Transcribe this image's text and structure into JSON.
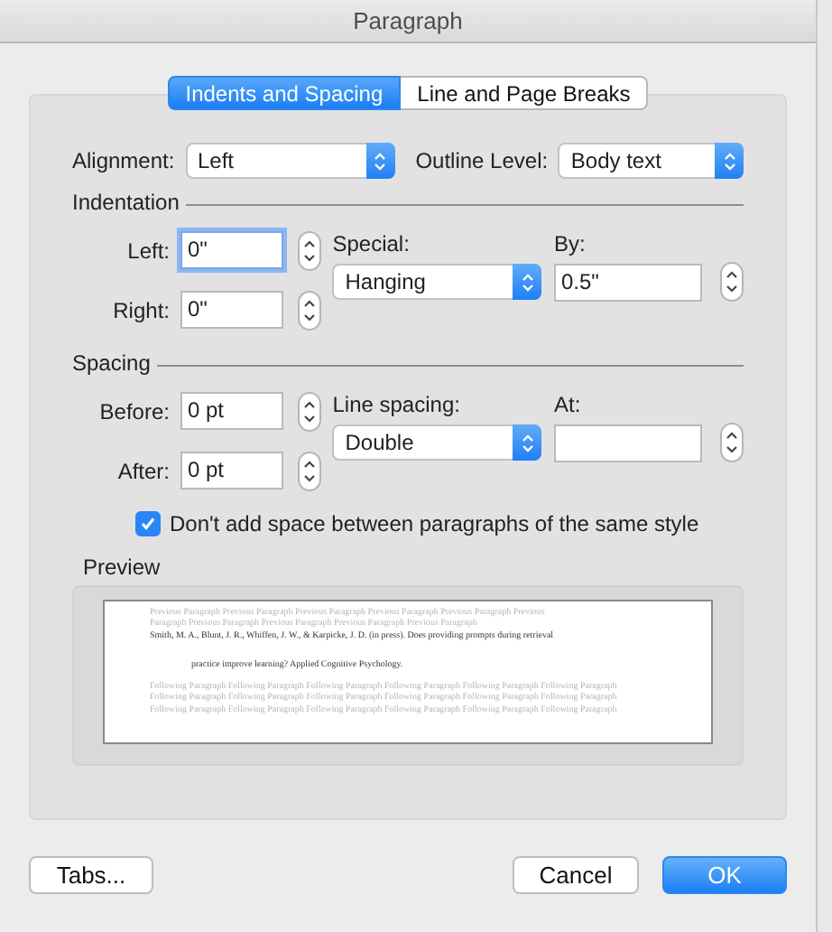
{
  "window": {
    "title": "Paragraph"
  },
  "tabs": [
    {
      "label": "Indents and Spacing",
      "selected": true
    },
    {
      "label": "Line and Page Breaks",
      "selected": false
    }
  ],
  "alignment": {
    "label": "Alignment:",
    "value": "Left"
  },
  "outline_level": {
    "label": "Outline Level:",
    "value": "Body text"
  },
  "indentation": {
    "heading": "Indentation",
    "left": {
      "label": "Left:",
      "value": "0\"",
      "focused": true
    },
    "right": {
      "label": "Right:",
      "value": "0\"",
      "focused": false
    },
    "special": {
      "label": "Special:",
      "value": "Hanging"
    },
    "by": {
      "label": "By:",
      "value": "0.5\""
    }
  },
  "spacing": {
    "heading": "Spacing",
    "before": {
      "label": "Before:",
      "value": "0 pt",
      "focused": false
    },
    "after": {
      "label": "After:",
      "value": "0 pt",
      "focused": false
    },
    "line_spacing": {
      "label": "Line spacing:",
      "value": "Double"
    },
    "at": {
      "label": "At:"
    }
  },
  "dont_add_space": {
    "label": "Don't add space between paragraphs of the same style",
    "checked": true
  },
  "preview": {
    "heading": "Preview",
    "previous_lines": [
      "Previous Paragraph Previous Paragraph Previous Paragraph Previous Paragraph Previous Paragraph Previous",
      "Paragraph Previous Paragraph Previous Paragraph Previous Paragraph Previous Paragraph"
    ],
    "current_lines": [
      "Smith, M. A., Blunt, J. R., Whiffen, J. W., & Karpicke, J. D. (in press). Does providing prompts during retrieval",
      "practice improve learning? Applied Cognitive Psychology."
    ],
    "following_lines": [
      "Following Paragraph Following Paragraph Following Paragraph Following Paragraph Following Paragraph Following Paragraph",
      "Following Paragraph Following Paragraph Following Paragraph Following Paragraph Following Paragraph Following Paragraph",
      "Following Paragraph Following Paragraph Following Paragraph Following Paragraph Following Paragraph Following Paragraph"
    ]
  },
  "buttons": {
    "tabs": "Tabs...",
    "cancel": "Cancel",
    "ok": "OK"
  }
}
